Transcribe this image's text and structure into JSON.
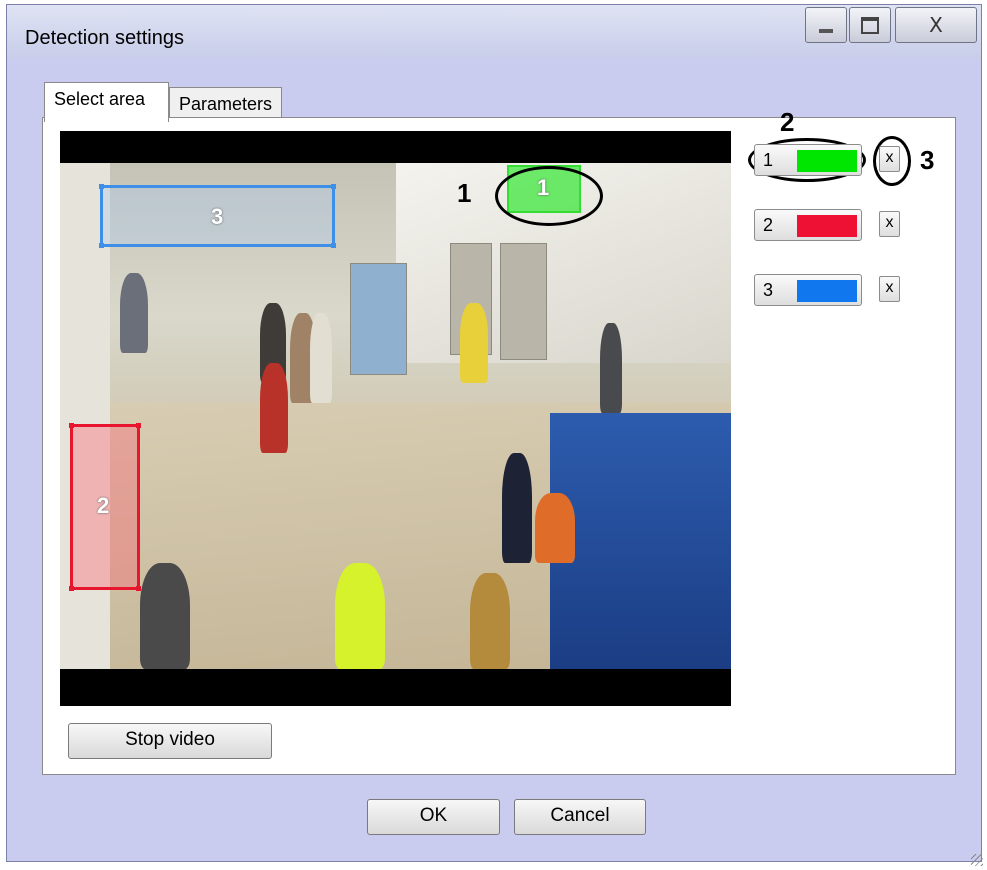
{
  "window": {
    "title": "Detection settings",
    "close_glyph": "X"
  },
  "tabs": [
    {
      "label": "Select area",
      "active": true
    },
    {
      "label": "Parameters",
      "active": false
    }
  ],
  "video": {
    "regions": [
      {
        "label": "1",
        "color": "#22dd22"
      },
      {
        "label": "2",
        "color": "#e8152f"
      },
      {
        "label": "3",
        "color": "#3d8fe8"
      }
    ]
  },
  "zone_list": [
    {
      "number": "1",
      "swatch_color": "#00e600",
      "delete_label": "x"
    },
    {
      "number": "2",
      "swatch_color": "#ee1133",
      "delete_label": "x"
    },
    {
      "number": "3",
      "swatch_color": "#1177ee",
      "delete_label": "x"
    }
  ],
  "annotations": {
    "callout_1": "1",
    "callout_2": "2",
    "callout_3": "3"
  },
  "buttons": {
    "stop_video": "Stop video",
    "ok": "OK",
    "cancel": "Cancel"
  }
}
